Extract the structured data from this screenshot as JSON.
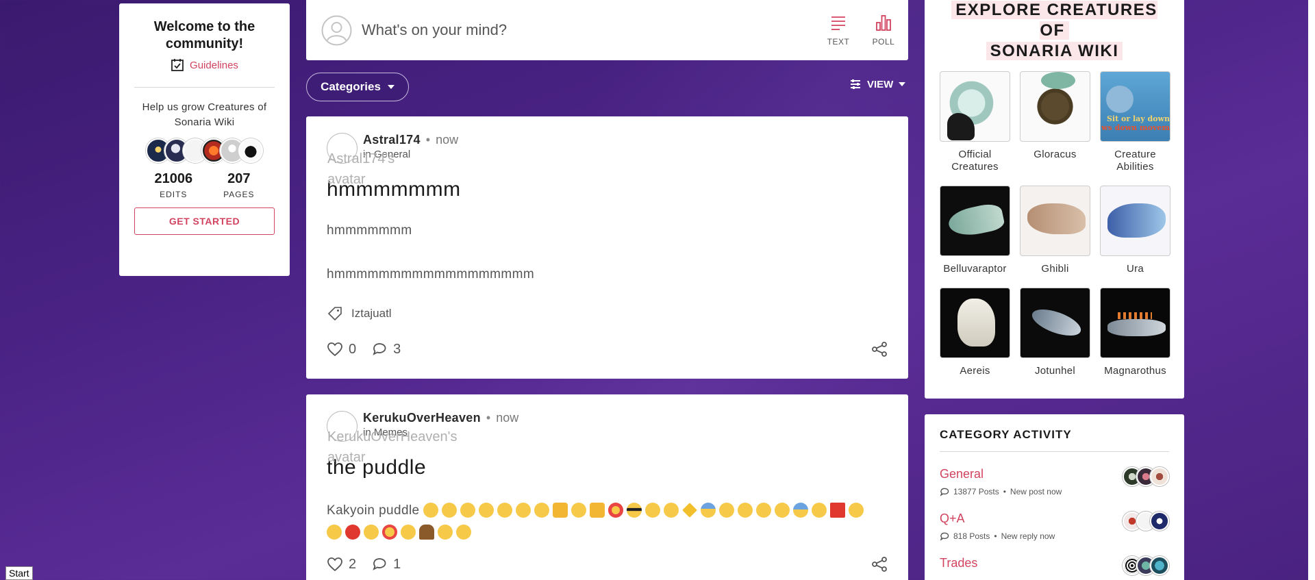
{
  "welcome_card": {
    "title": "Welcome to the community!",
    "guidelines_label": "Guidelines",
    "help_text": "Help us grow Creatures of Sonaria Wiki",
    "edits_value": "21006",
    "edits_label": "EDITS",
    "pages_value": "207",
    "pages_label": "PAGES",
    "get_started_label": "GET STARTED"
  },
  "composer": {
    "prompt": "What's on your mind?",
    "text_label": "TEXT",
    "poll_label": "POLL"
  },
  "filters": {
    "categories_label": "Categories",
    "view_label": "VIEW"
  },
  "posts": [
    {
      "author": "Astral174",
      "time": "now",
      "category": "in General",
      "avatar_alt": "Astral174's avatar",
      "title": "hmmmmmmm",
      "body_line_1": "hmmmmmmm",
      "body_line_2": "hmmmmmmmmmmmmmmmmmm",
      "tag": "Iztajuatl",
      "likes": "0",
      "replies": "3"
    },
    {
      "author": "KerukuOverHeaven",
      "time": "now",
      "category": "in Memes",
      "avatar_alt": "KerukuOverHeaven's avatar",
      "title": "the puddle",
      "body_text": "Kakyoin puddle",
      "likes": "2",
      "replies": "1"
    }
  ],
  "explore": {
    "title_line_1": "EXPLORE CREATURES OF",
    "title_line_2": "SONARIA WIKI",
    "tiles": [
      {
        "label": "Official Creatures"
      },
      {
        "label": "Gloracus"
      },
      {
        "label": "Creature Abilities",
        "overlay_text_1": "Sit or lay down",
        "overlay_text_2": "ws down movem"
      },
      {
        "label": "Belluvaraptor"
      },
      {
        "label": "Ghibli"
      },
      {
        "label": "Ura"
      },
      {
        "label": "Aereis"
      },
      {
        "label": "Jotunhel"
      },
      {
        "label": "Magnarothus"
      }
    ]
  },
  "category_activity": {
    "title": "CATEGORY ACTIVITY",
    "items": [
      {
        "name": "General",
        "posts": "13877 Posts",
        "status": "New post now"
      },
      {
        "name": "Q+A",
        "posts": "818 Posts",
        "status": "New reply now"
      },
      {
        "name": "Trades",
        "posts": "",
        "status": ""
      }
    ]
  },
  "taskbar": {
    "start_label": "Start"
  },
  "colors": {
    "accent": "#d2435f",
    "background": "#4b2386",
    "card": "#ffffff"
  },
  "icons": [
    "guidelines-check-icon",
    "user-avatar-icon",
    "text-post-icon",
    "poll-icon",
    "caret-down-icon",
    "view-sliders-icon",
    "tag-icon",
    "heart-icon",
    "comment-icon",
    "share-icon"
  ]
}
